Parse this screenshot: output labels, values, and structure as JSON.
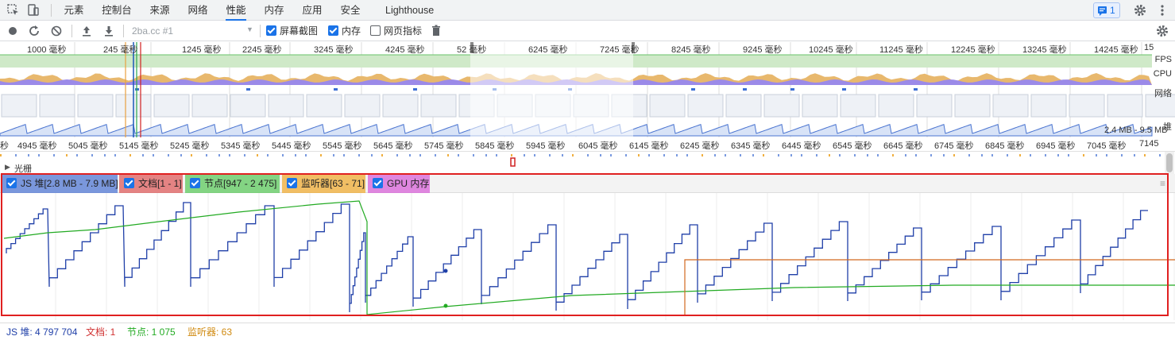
{
  "tabs": [
    {
      "label": "元素",
      "active": false
    },
    {
      "label": "控制台",
      "active": false
    },
    {
      "label": "来源",
      "active": false
    },
    {
      "label": "网络",
      "active": false
    },
    {
      "label": "性能",
      "active": true
    },
    {
      "label": "内存",
      "active": false
    },
    {
      "label": "应用",
      "active": false
    },
    {
      "label": "安全",
      "active": false
    },
    {
      "label": "Lighthouse",
      "active": false
    }
  ],
  "issues_count": "1",
  "toolbar": {
    "profile_select": "2ba.cc #1",
    "screenshots_label": "屏幕截图",
    "screenshots_checked": true,
    "memory_label": "内存",
    "memory_checked": true,
    "webvitals_label": "网页指标",
    "webvitals_checked": false
  },
  "overview": {
    "ticks": [
      "1000 毫秒",
      "245 毫秒",
      "1245 毫秒",
      "2245 毫秒",
      "3245 毫秒",
      "4245 毫秒",
      "52 毫秒",
      "6245 毫秒",
      "7245 毫秒",
      "8245 毫秒",
      "9245 毫秒",
      "10245 毫秒",
      "11245 毫秒",
      "12245 毫秒",
      "13245 毫秒",
      "14245 毫秒",
      "15"
    ],
    "track_labels": {
      "fps": "FPS",
      "cpu": "CPU",
      "net": "网络",
      "heap": "堆"
    },
    "heap_range": "2.4 MB - 9.5 MB"
  },
  "ruler": {
    "ticks": [
      "秒",
      "4945 毫秒",
      "5045 毫秒",
      "5145 毫秒",
      "5245 毫秒",
      "5345 毫秒",
      "5445 毫秒",
      "5545 毫秒",
      "5645 毫秒",
      "5745 毫秒",
      "5845 毫秒",
      "5945 毫秒",
      "6045 毫秒",
      "6145 毫秒",
      "6245 毫秒",
      "6345 毫秒",
      "6445 毫秒",
      "6545 毫秒",
      "6645 毫秒",
      "6745 毫秒",
      "6845 毫秒",
      "6945 毫秒",
      "7045 毫秒",
      "7145"
    ],
    "track_label": "光栅"
  },
  "legend": [
    {
      "label": "JS 堆[2.8 MB - 7.9 MB]",
      "color": "#5b7fd6",
      "checked": true
    },
    {
      "label": "文档[1 - 1]",
      "color": "#e06666",
      "checked": true
    },
    {
      "label": "节点[947 - 2 475]",
      "color": "#66cc66",
      "checked": true
    },
    {
      "label": "监听器[63 - 71]",
      "color": "#f0b040",
      "checked": true
    },
    {
      "label": "GPU 内存",
      "color": "#d96ad9",
      "checked": true
    }
  ],
  "status": {
    "js_heap": "JS 堆: 4 797 704",
    "documents": "文档: 1",
    "nodes": "节点: 1 075",
    "listeners": "监听器: 63"
  },
  "colors": {
    "js_heap": "#1f3fa8",
    "nodes": "#22aa22",
    "listeners": "#d2691e",
    "highlight": "#e02020"
  }
}
